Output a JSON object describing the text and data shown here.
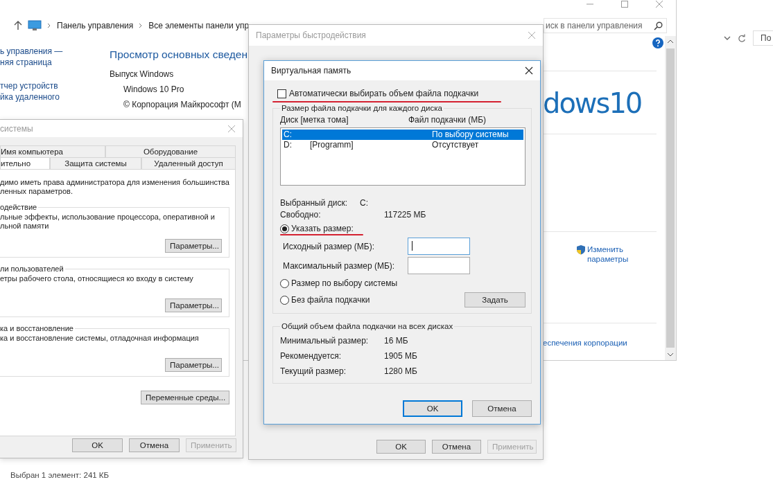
{
  "background_window": {
    "breadcrumb": [
      "Панель управления",
      "Все элементы панели упр"
    ],
    "search": {
      "placeholder": "иск в панели управления"
    },
    "sidebar": [
      "ь управления —",
      "няя страница",
      "тчер устройств",
      "йка удаленного"
    ],
    "heading": "Просмотр основных сведен",
    "edition_label": "Выпуск Windows",
    "edition": "Windows 10 Pro",
    "copyright": "© Корпорация Майкрософт (М",
    "logo_text": "dows10",
    "change_link": "Изменить параметры",
    "footer_link": "еспечения корпорации"
  },
  "behind_window": {
    "button_text": "По"
  },
  "system_properties": {
    "title": "системы",
    "tab_rows": [
      [
        {
          "label": "Имя компьютера",
          "selected": false
        },
        {
          "label": "Оборудование",
          "selected": false
        }
      ],
      [
        {
          "label": "ительно",
          "selected": true
        },
        {
          "label": "Защита системы",
          "selected": false
        },
        {
          "label": "Удаленный доступ",
          "selected": false
        }
      ]
    ],
    "note": "димо иметь права администратора для изменения большинства ленных параметров.",
    "groups": [
      {
        "title": "одействие",
        "text": "льные эффекты, использование процессора, оперативной и льной памяти",
        "button": "Параметры..."
      },
      {
        "title": "ли пользователей",
        "text": "етры рабочего стола, относящиеся ко входу в систему",
        "button": "Параметры..."
      },
      {
        "title": "ка и восстановление",
        "text": "ка и восстановление системы, отладочная информация",
        "button": "Параметры..."
      }
    ],
    "env_button": "Переменные среды...",
    "buttons": [
      {
        "label": "OK",
        "disabled": false
      },
      {
        "label": "Отмена",
        "disabled": false
      },
      {
        "label": "Применить",
        "disabled": true
      }
    ]
  },
  "performance_options": {
    "title": "Параметры быстродействия",
    "buttons": [
      {
        "label": "OK",
        "disabled": false
      },
      {
        "label": "Отмена",
        "disabled": false
      },
      {
        "label": "Применить",
        "disabled": true
      }
    ]
  },
  "virtual_memory": {
    "title": "Виртуальная память",
    "auto": {
      "label": "Автоматически выбирать объем файла подкачки",
      "checked": false
    },
    "group_title": "Размер файла подкачки для каждого диска",
    "columns": [
      "Диск [метка тома]",
      "Файл подкачки (МБ)"
    ],
    "disks": [
      {
        "disk": "C:",
        "file": "По выбору системы",
        "selected": true
      },
      {
        "disk": "D:",
        "label": "[Programm]",
        "file": "Отсутствует",
        "selected": false
      }
    ],
    "selected_disk": {
      "label": "Выбранный диск:",
      "value": "C:"
    },
    "free": {
      "label": "Свободно:",
      "value": "117225 МБ"
    },
    "options": [
      {
        "kind": "custom",
        "label": "Указать размер:",
        "selected": true
      },
      {
        "kind": "system",
        "label": "Размер по выбору системы",
        "selected": false
      },
      {
        "kind": "none",
        "label": "Без файла подкачки",
        "selected": false
      }
    ],
    "initial_label": "Исходный размер (МБ):",
    "max_label": "Максимальный размер (МБ):",
    "set_button": "Задать",
    "total_title": "Общий объем файла подкачки на всех дисках",
    "totals": [
      {
        "label": "Минимальный размер:",
        "value": "16 МБ"
      },
      {
        "label": "Рекомендуется:",
        "value": "1905 МБ"
      },
      {
        "label": "Текущий размер:",
        "value": "1280 МБ"
      }
    ],
    "buttons": [
      {
        "label": "OK",
        "default": true
      },
      {
        "label": "Отмена",
        "default": false
      }
    ]
  },
  "status_bar": {
    "text": "Выбран 1 элемент: 241 КБ"
  }
}
